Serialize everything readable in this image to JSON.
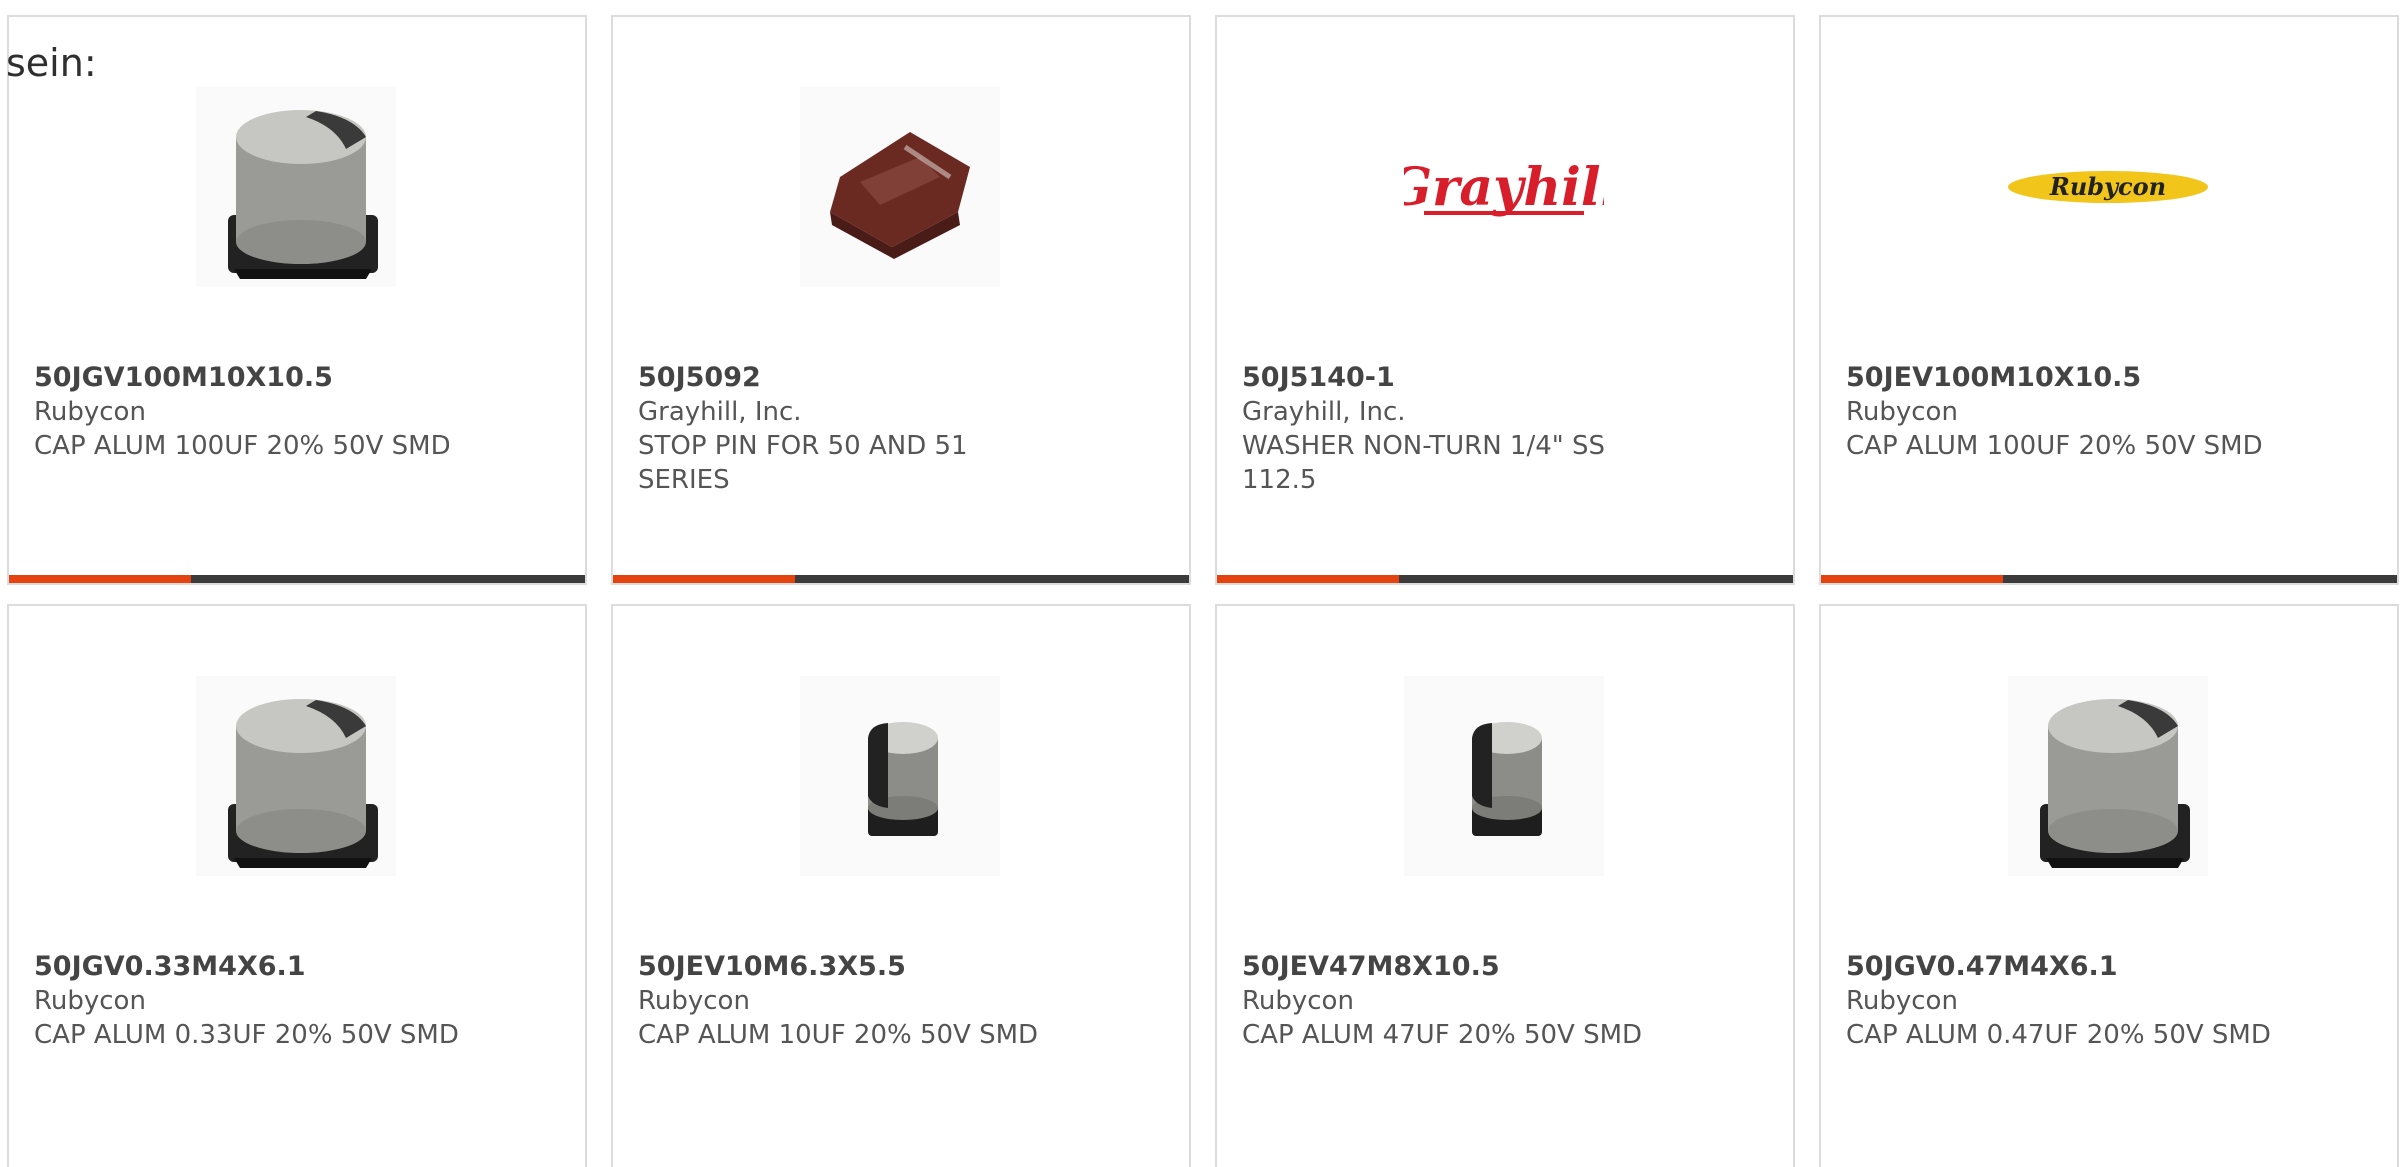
{
  "intro": "sein:",
  "cards": [
    {
      "part": "50JGV100M10X10.5",
      "maker": "Rubycon",
      "desc": "CAP ALUM 100UF 20% 50V SMD",
      "image": "capacitor-large"
    },
    {
      "part": "50J5092",
      "maker": "Grayhill, Inc.",
      "desc": "STOP PIN FOR 50 AND 51 SERIES",
      "image": "stop-pin"
    },
    {
      "part": "50J5140-1",
      "maker": "Grayhill, Inc.",
      "desc": "WASHER NON-TURN 1/4\" SS 112.5",
      "image": "grayhill-logo"
    },
    {
      "part": "50JEV100M10X10.5",
      "maker": "Rubycon",
      "desc": "CAP ALUM 100UF 20% 50V SMD",
      "image": "rubycon-logo"
    },
    {
      "part": "50JGV0.33M4X6.1",
      "maker": "Rubycon",
      "desc": "CAP ALUM 0.33UF 20% 50V SMD",
      "image": "capacitor-large"
    },
    {
      "part": "50JEV10M6.3X5.5",
      "maker": "Rubycon",
      "desc": "CAP ALUM 10UF 20% 50V SMD",
      "image": "capacitor-small"
    },
    {
      "part": "50JEV47M8X10.5",
      "maker": "Rubycon",
      "desc": "CAP ALUM 47UF 20% 50V SMD",
      "image": "capacitor-small"
    },
    {
      "part": "50JGV0.47M4X6.1",
      "maker": "Rubycon",
      "desc": "CAP ALUM 0.47UF 20% 50V SMD",
      "image": "capacitor-large"
    }
  ],
  "logos": {
    "grayhill": "Grayhill",
    "rubycon": "Rubycon"
  },
  "colors": {
    "accent": "#e4430f",
    "bar": "#3b3b3b",
    "border": "#dcdcdc"
  }
}
